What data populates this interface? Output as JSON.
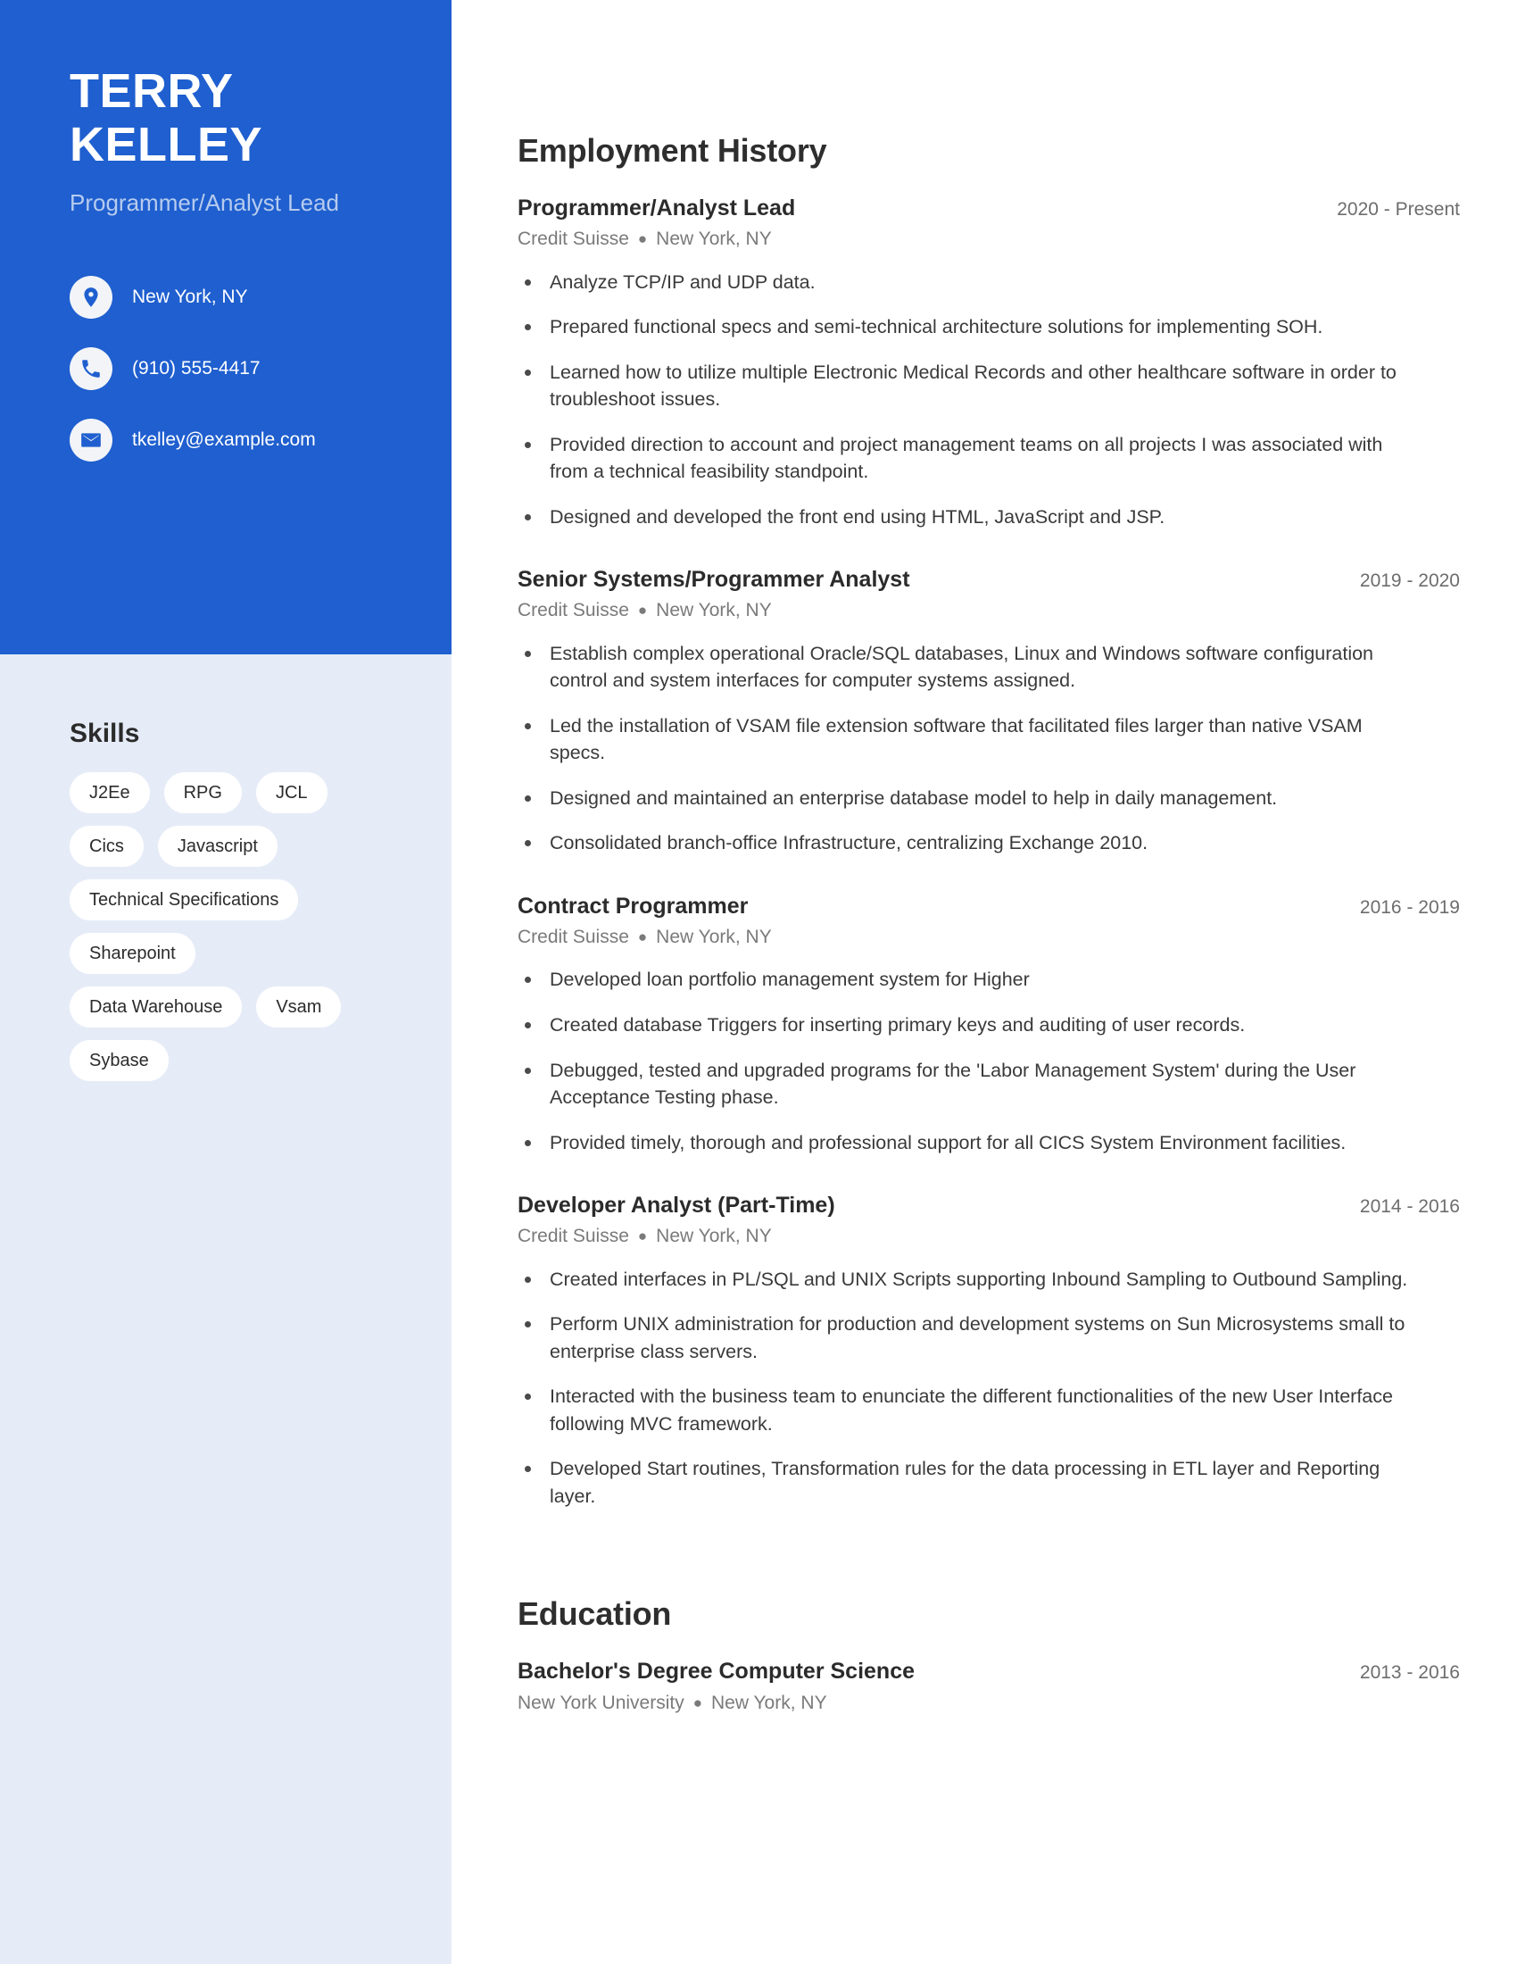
{
  "theme": {
    "accent": "#1f5fcf",
    "sidebar_bg": "#e6ecf7",
    "pill_bg": "#ffffff",
    "subtitle_color": "#b6cbee"
  },
  "header": {
    "first_name": "TERRY",
    "last_name": "KELLEY",
    "job_title": "Programmer/Analyst Lead"
  },
  "contact": {
    "items": [
      {
        "icon": "location-pin-icon",
        "value": "New York, NY"
      },
      {
        "icon": "phone-icon",
        "value": "(910) 555-4417"
      },
      {
        "icon": "envelope-icon",
        "value": "tkelley@example.com"
      }
    ]
  },
  "skills": {
    "title": "Skills",
    "items": [
      "J2Ee",
      "RPG",
      "JCL",
      "Cics",
      "Javascript",
      "Technical Specifications",
      "Sharepoint",
      "Data Warehouse",
      "Vsam",
      "Sybase"
    ]
  },
  "employment": {
    "title": "Employment History",
    "entries": [
      {
        "role": "Programmer/Analyst Lead",
        "dates": "2020 - Present",
        "company": "Credit Suisse",
        "location": "New York, NY",
        "bullets": [
          "Analyze TCP/IP and UDP data.",
          "Prepared functional specs and semi-technical architecture solutions for implementing SOH.",
          "Learned how to utilize multiple Electronic Medical Records and other healthcare software in order to troubleshoot issues.",
          "Provided direction to account and project management teams on all projects I was associated with from a technical feasibility standpoint.",
          "Designed and developed the front end using HTML, JavaScript and JSP."
        ]
      },
      {
        "role": "Senior Systems/Programmer Analyst",
        "dates": "2019 - 2020",
        "company": "Credit Suisse",
        "location": "New York, NY",
        "bullets": [
          "Establish complex operational Oracle/SQL databases, Linux and Windows software configuration control and system interfaces for computer systems assigned.",
          "Led the installation of VSAM file extension software that facilitated files larger than native VSAM specs.",
          "Designed and maintained an enterprise database model to help in daily management.",
          "Consolidated branch-office Infrastructure, centralizing Exchange 2010."
        ]
      },
      {
        "role": "Contract Programmer",
        "dates": "2016 - 2019",
        "company": "Credit Suisse",
        "location": "New York, NY",
        "bullets": [
          "Developed loan portfolio management system for Higher",
          "Created database Triggers for inserting primary keys and auditing of user records.",
          "Debugged, tested and upgraded programs for the 'Labor Management System' during the User Acceptance Testing phase.",
          "Provided timely, thorough and professional support for all CICS System Environment facilities."
        ]
      },
      {
        "role": "Developer Analyst (Part-Time)",
        "dates": "2014 - 2016",
        "company": "Credit Suisse",
        "location": "New York, NY",
        "bullets": [
          "Created interfaces in PL/SQL and UNIX Scripts supporting Inbound Sampling to Outbound Sampling.",
          "Perform UNIX administration for production and development systems on Sun Microsystems small to enterprise class servers.",
          "Interacted with the business team to enunciate the different functionalities of the new User Interface following MVC framework.",
          "Developed Start routines, Transformation rules for the data processing in ETL layer and Reporting layer."
        ]
      }
    ]
  },
  "education": {
    "title": "Education",
    "entries": [
      {
        "degree": "Bachelor's Degree Computer Science",
        "dates": "2013 - 2016",
        "school": "New York University",
        "location": "New York, NY"
      }
    ]
  },
  "separator": "●"
}
